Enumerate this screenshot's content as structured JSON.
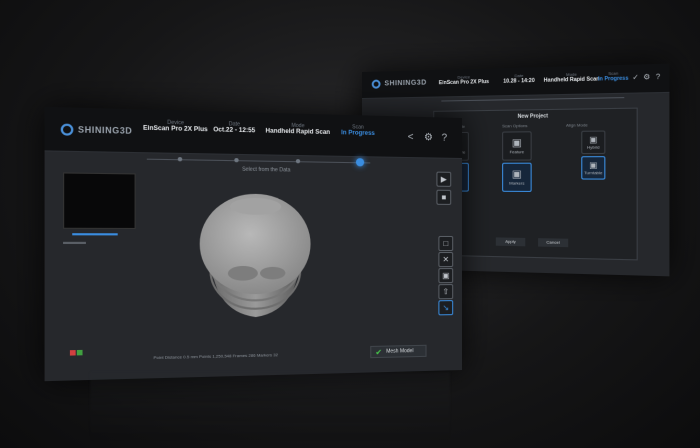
{
  "brand": "SHINING3D",
  "back_window": {
    "steps": [
      {
        "caption": "Device",
        "value": "EinScan Pro 2X Plus"
      },
      {
        "caption": "Date",
        "value": "10.28 - 14:20"
      },
      {
        "caption": "Mode",
        "value": "Handheld Rapid Scan"
      },
      {
        "caption": "Scan",
        "value": "In Progress"
      }
    ],
    "dialog_title": "New Project",
    "section_labels": [
      "Texture Mode",
      "Scan Options",
      "Align Mode"
    ],
    "options": [
      "Non-texture",
      "Texture",
      "Feature",
      "Markers",
      "Hybrid",
      "Turntable"
    ],
    "buttons": [
      "Apply",
      "Cancel"
    ]
  },
  "front_window": {
    "steps": [
      {
        "caption": "Device",
        "value": "EinScan Pro 2X Plus"
      },
      {
        "caption": "Date",
        "value": "Oct.22 - 12:55"
      },
      {
        "caption": "Mode",
        "value": "Handheld Rapid Scan"
      },
      {
        "caption": "Scan",
        "value": "In Progress"
      }
    ],
    "subtitle": "Select from the Data",
    "footer_status": "Point Distance 0.5 mm  Points 1,250,548  Frames 286  Markers 32",
    "mesh_button": "Mesh Model",
    "toolbar_right": [
      "play-icon",
      "stop-icon",
      "folder-icon",
      "delete-icon",
      "save-icon",
      "export-icon",
      "measure-icon"
    ]
  },
  "colors": {
    "accent": "#3a8de0",
    "confirm": "#46c24a"
  }
}
